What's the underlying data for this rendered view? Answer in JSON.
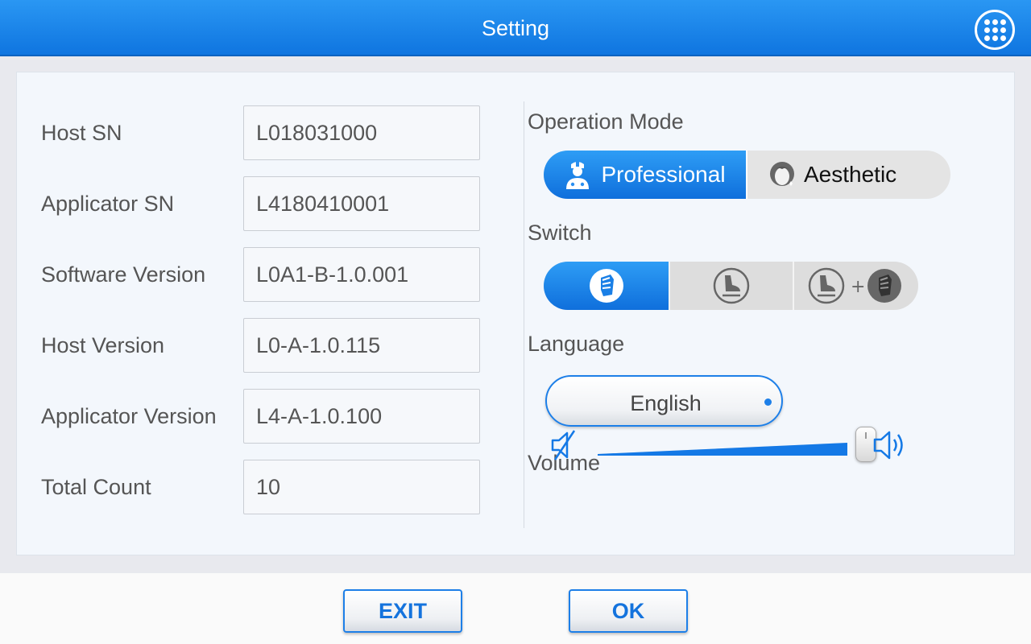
{
  "header": {
    "title": "Setting",
    "menu_icon": "apps-grid-icon"
  },
  "device_info": [
    {
      "label": "Host SN",
      "value": "L018031000"
    },
    {
      "label": "Applicator SN",
      "value": "L4180410001"
    },
    {
      "label": "Software Version",
      "value": "L0A1-B-1.0.001"
    },
    {
      "label": "Host Version",
      "value": "L0-A-1.0.115"
    },
    {
      "label": "Applicator Version",
      "value": "L4-A-1.0.100"
    },
    {
      "label": "Total Count",
      "value": "10"
    }
  ],
  "operation_mode": {
    "label": "Operation Mode",
    "options": [
      {
        "label": "Professional",
        "icon": "doctor-icon",
        "selected": true
      },
      {
        "label": "Aesthetic",
        "icon": "woman-face-icon",
        "selected": false
      }
    ]
  },
  "switch": {
    "label": "Switch",
    "options": [
      {
        "icon": "hand-applicator-icon",
        "selected": true
      },
      {
        "icon": "foot-switch-icon",
        "selected": false
      },
      {
        "icon": "foot-plus-hand-icon",
        "selected": false
      }
    ]
  },
  "language": {
    "label": "Language",
    "value": "English"
  },
  "volume": {
    "label": "Volume",
    "level": 1.0
  },
  "footer": {
    "exit_label": "EXIT",
    "ok_label": "OK"
  },
  "colors": {
    "accent": "#1479e6",
    "panel": "#f3f7fc"
  }
}
